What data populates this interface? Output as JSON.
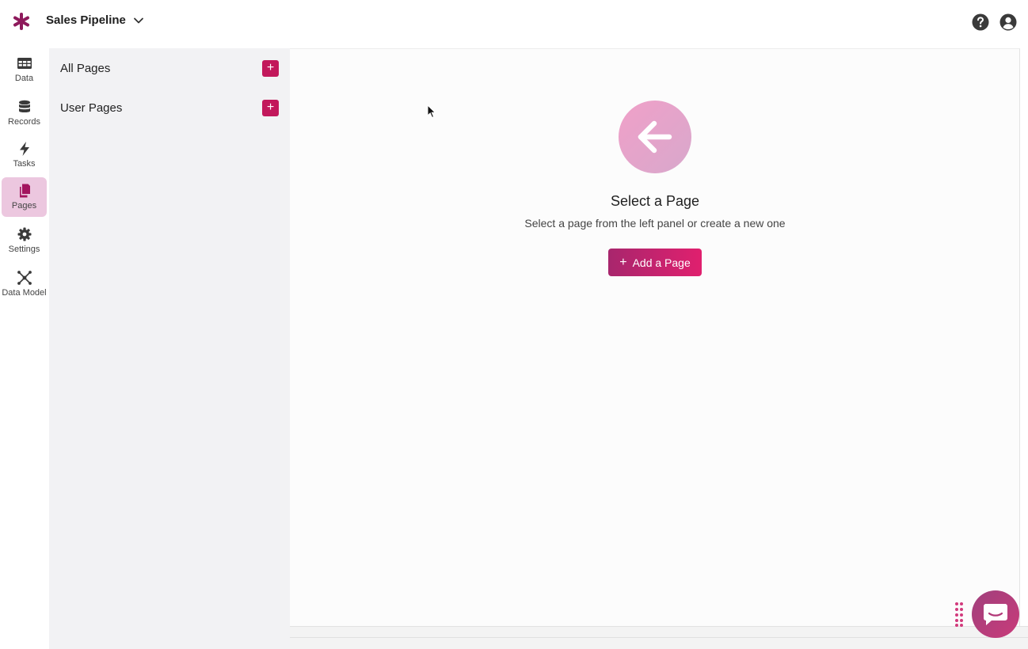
{
  "app": {
    "title": "Sales Pipeline",
    "brand_color": "#c2185b"
  },
  "rail": {
    "items": [
      {
        "label": "Data",
        "icon": "table-icon"
      },
      {
        "label": "Records",
        "icon": "database-icon"
      },
      {
        "label": "Tasks",
        "icon": "bolt-icon"
      },
      {
        "label": "Pages",
        "icon": "pages-icon",
        "active": true
      },
      {
        "label": "Settings",
        "icon": "gear-icon"
      },
      {
        "label": "Data Model",
        "icon": "network-icon"
      }
    ]
  },
  "pages_panel": {
    "sections": [
      {
        "label": "All Pages",
        "add_label": "+"
      },
      {
        "label": "User Pages",
        "add_label": "+"
      }
    ]
  },
  "main": {
    "title": "Select a Page",
    "subtitle": "Select a page from the left panel or create a new one",
    "add_button_plus": "+",
    "add_button_label": "Add a Page"
  }
}
